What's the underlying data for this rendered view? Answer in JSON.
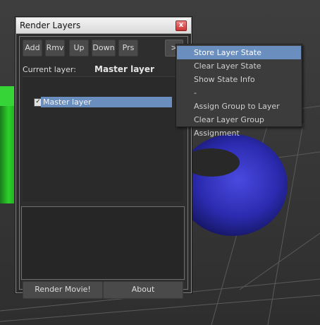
{
  "window": {
    "title": "Render Layers",
    "close_glyph": "x"
  },
  "toolbar": {
    "buttons": [
      "Add",
      "Rmv",
      "Up",
      "Down",
      "Prs"
    ],
    "more": ">"
  },
  "current_layer": {
    "label": "Current layer:",
    "value": "Master layer"
  },
  "layers": [
    {
      "name": "Master layer",
      "checked": true,
      "selected": true
    }
  ],
  "check_glyph": "✓",
  "bottom": {
    "render": "Render Movie!",
    "about": "About"
  },
  "menu": {
    "items": [
      {
        "label": "Store Layer State",
        "highlighted": true
      },
      {
        "label": "Clear Layer State",
        "highlighted": false
      },
      {
        "label": "Show State Info",
        "highlighted": false
      },
      {
        "label": "-",
        "highlighted": false
      },
      {
        "label": "Assign Group to Layer",
        "highlighted": false
      },
      {
        "label": "Clear Layer Group Assignment",
        "highlighted": false
      }
    ]
  },
  "colors": {
    "selection": "#6a8fbe",
    "torus": "#2b2bb0",
    "green_object": "#2bd12b"
  }
}
